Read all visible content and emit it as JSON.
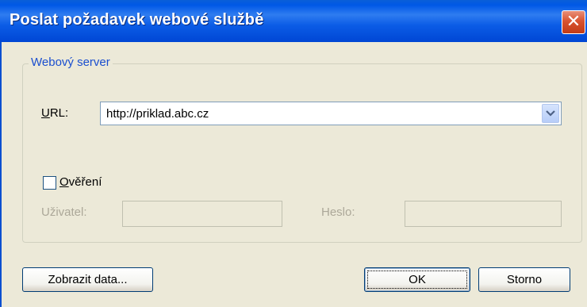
{
  "window": {
    "title": "Poslat požadavek webové službě",
    "close_glyph": "✕"
  },
  "group": {
    "legend": "Webový server"
  },
  "url": {
    "label_first": "U",
    "label_rest": "RL:",
    "value": "http://priklad.abc.cz"
  },
  "auth": {
    "label_first": "O",
    "label_rest": "věření",
    "checked": false
  },
  "user": {
    "label": "Uživatel:",
    "value": ""
  },
  "password": {
    "label": "Heslo:",
    "value": ""
  },
  "buttons": {
    "show_data": "Zobrazit data...",
    "ok": "OK",
    "cancel": "Storno"
  },
  "colors": {
    "titlebar": "#0058e6",
    "dialog_bg": "#ece9d8",
    "legend_text": "#1a4ecf",
    "close_button": "#d9532f"
  }
}
